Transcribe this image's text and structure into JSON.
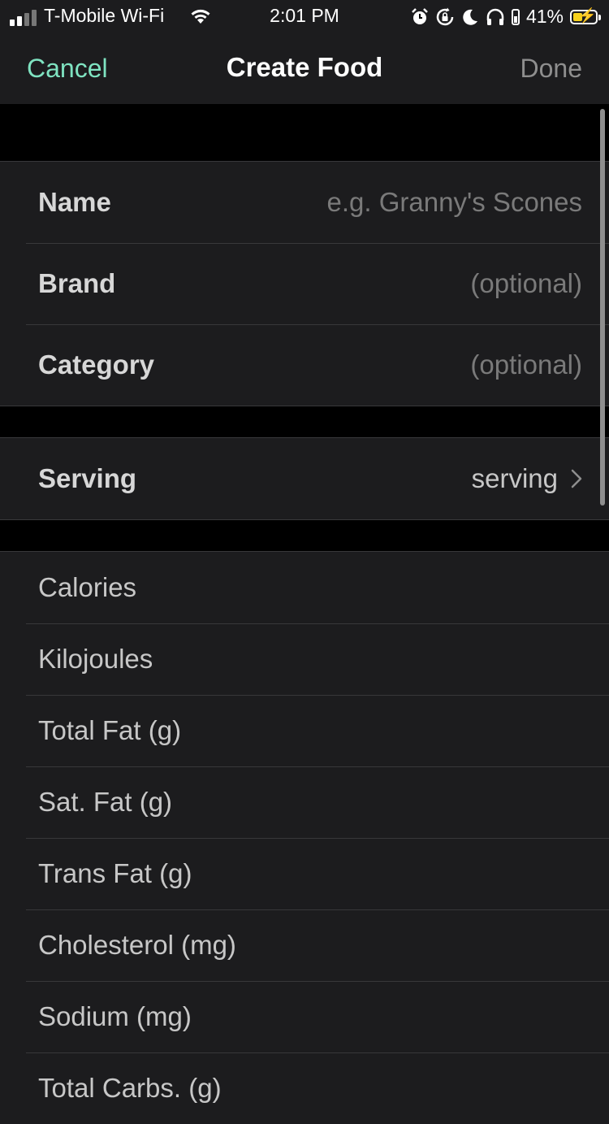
{
  "status_bar": {
    "carrier": "T-Mobile Wi-Fi",
    "time": "2:01 PM",
    "battery_percent": "41%",
    "battery_level": 0.41,
    "icons": [
      "signal-icon",
      "wifi-icon",
      "alarm-icon",
      "orientation-lock-icon",
      "moon-icon",
      "headphones-icon",
      "battery-icon"
    ]
  },
  "nav": {
    "cancel_label": "Cancel",
    "title": "Create Food",
    "done_label": "Done"
  },
  "info_group": {
    "name": {
      "label": "Name",
      "placeholder": "e.g. Granny's Scones"
    },
    "brand": {
      "label": "Brand",
      "placeholder": "(optional)"
    },
    "category": {
      "label": "Category",
      "placeholder": "(optional)"
    }
  },
  "serving_group": {
    "label": "Serving",
    "value": "serving"
  },
  "nutrients": [
    "Calories",
    "Kilojoules",
    "Total Fat (g)",
    "Sat. Fat (g)",
    "Trans Fat (g)",
    "Cholesterol (mg)",
    "Sodium (mg)",
    "Total Carbs. (g)"
  ],
  "colors": {
    "accent": "#7fe3c1",
    "background": "#000000",
    "cell": "#1c1c1e",
    "battery": "#f7d21c"
  }
}
